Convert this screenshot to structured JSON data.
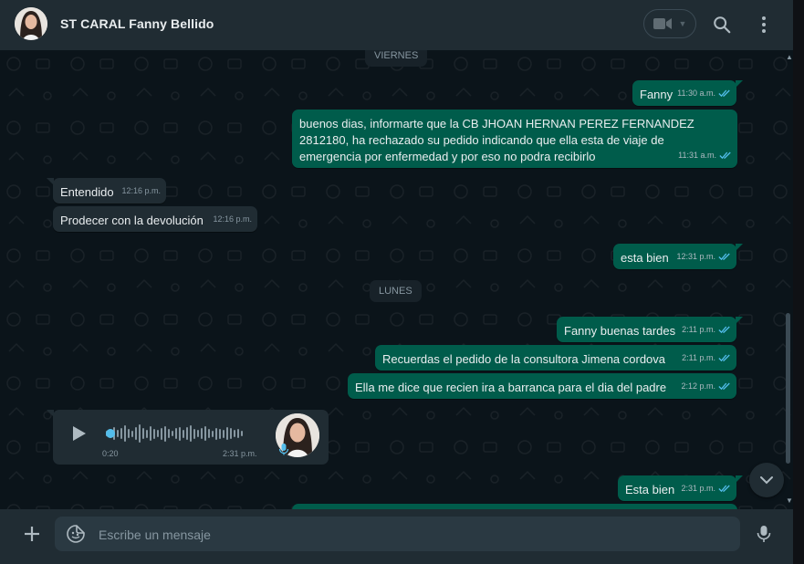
{
  "header": {
    "title": "ST CARAL Fanny Bellido",
    "video_icon": "video-camera-icon",
    "dropdown_icon": "chevron-down-icon",
    "search_icon": "search-icon",
    "menu_icon": "vertical-dots-icon"
  },
  "days": {
    "friday": "VIERNES",
    "monday": "LUNES"
  },
  "messages": {
    "m1": {
      "text": "Fanny",
      "time": "11:30 a.m.",
      "direction": "outgoing"
    },
    "m2": {
      "text": "buenos dias, informarte que la CB JHOAN HERNAN  PEREZ FERNANDEZ 2812180, ha rechazado su pedido indicando que ella esta de viaje de emergencia por enfermedad y por eso no podra recibirlo",
      "time": "11:31 a.m.",
      "direction": "outgoing"
    },
    "m3": {
      "text": "Entendido",
      "time": "12:16 p.m.",
      "direction": "incoming"
    },
    "m4": {
      "text": "Prodecer con la devolución",
      "time": "12:16 p.m.",
      "direction": "incoming"
    },
    "m5": {
      "text": "esta bien",
      "time": "12:31 p.m.",
      "direction": "outgoing"
    },
    "m6": {
      "text": "Fanny buenas tardes",
      "time": "2:11 p.m.",
      "direction": "outgoing"
    },
    "m7": {
      "text": "Recuerdas el pedido de la consultora  Jimena cordova",
      "time": "2:11 p.m.",
      "direction": "outgoing"
    },
    "m8": {
      "text": "Ella me dice que recien ira a barranca para el dia del padre",
      "time": "2:12 p.m.",
      "direction": "outgoing"
    },
    "m9": {
      "text": "Esta bien",
      "time": "2:31 p.m.",
      "direction": "outgoing"
    }
  },
  "voice_note": {
    "duration": "0:20",
    "time": "2:31 p.m.",
    "progress": 0
  },
  "composer": {
    "placeholder": "Escribe un mensaje"
  },
  "colors": {
    "outgoing_bubble": "#005c4b",
    "incoming_bubble": "#202c33",
    "read_ticks": "#53bdeb",
    "background": "#0b141a"
  }
}
